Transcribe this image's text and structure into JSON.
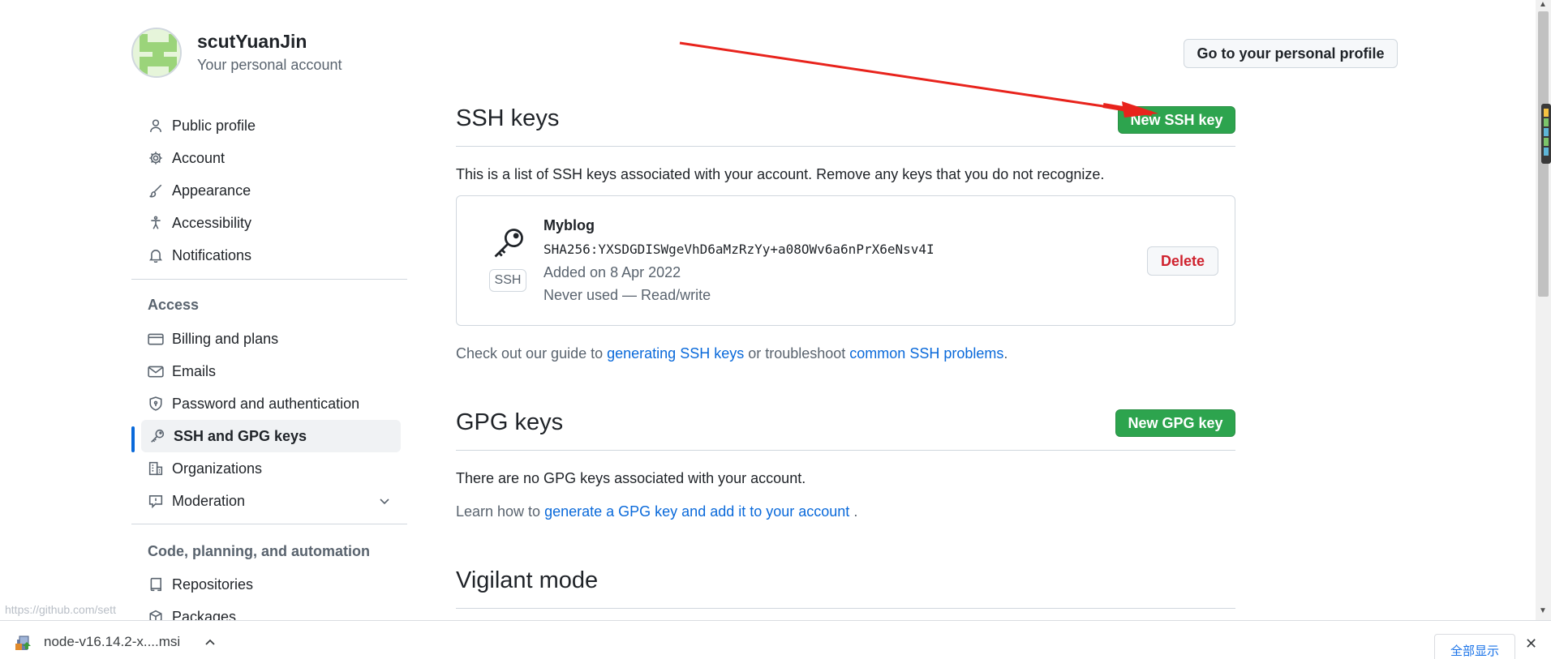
{
  "account": {
    "name": "scutYuanJin",
    "subtitle": "Your personal account",
    "profile_button": "Go to your personal profile"
  },
  "sidebar": {
    "items": [
      {
        "label": "Public profile",
        "icon": "person-icon"
      },
      {
        "label": "Account",
        "icon": "gear-icon"
      },
      {
        "label": "Appearance",
        "icon": "paintbrush-icon"
      },
      {
        "label": "Accessibility",
        "icon": "accessibility-icon"
      },
      {
        "label": "Notifications",
        "icon": "bell-icon"
      }
    ],
    "access_heading": "Access",
    "access_items": [
      {
        "label": "Billing and plans",
        "icon": "credit-card-icon"
      },
      {
        "label": "Emails",
        "icon": "mail-icon"
      },
      {
        "label": "Password and authentication",
        "icon": "shield-lock-icon"
      },
      {
        "label": "SSH and GPG keys",
        "icon": "key-icon",
        "active": true
      },
      {
        "label": "Organizations",
        "icon": "organization-icon"
      },
      {
        "label": "Moderation",
        "icon": "report-icon"
      }
    ],
    "code_heading": "Code, planning, and automation",
    "code_items": [
      {
        "label": "Repositories",
        "icon": "repo-icon"
      },
      {
        "label": "Packages",
        "icon": "package-icon"
      }
    ]
  },
  "ssh": {
    "title": "SSH keys",
    "new_button": "New SSH key",
    "description": "This is a list of SSH keys associated with your account. Remove any keys that you do not recognize.",
    "key": {
      "badge": "SSH",
      "title": "Myblog",
      "fingerprint": "SHA256:YXSDGDISWgeVhD6aMzRzYy+a08OWv6a6nPrX6eNsv4I",
      "added": "Added on 8 Apr 2022",
      "used": "Never used — Read/write",
      "delete_button": "Delete"
    },
    "guide_prefix": "Check out our guide to ",
    "guide_link1": "generating SSH keys",
    "guide_middle": " or troubleshoot ",
    "guide_link2": "common SSH problems",
    "guide_suffix": "."
  },
  "gpg": {
    "title": "GPG keys",
    "new_button": "New GPG key",
    "empty": "There are no GPG keys associated with your account.",
    "learn_prefix": "Learn how to ",
    "learn_link": "generate a GPG key and add it to your account",
    "learn_suffix": " ."
  },
  "vigilant": {
    "title": "Vigilant mode"
  },
  "status_url": "https://github.com/sett",
  "download_bar": {
    "file_name": "node-v16.14.2-x....msi",
    "show_all": "全部显示"
  },
  "colors": {
    "accent_green": "#2da44e",
    "link_blue": "#0969da",
    "danger_red": "#cf222e",
    "annotation_arrow": "#e8231c"
  }
}
